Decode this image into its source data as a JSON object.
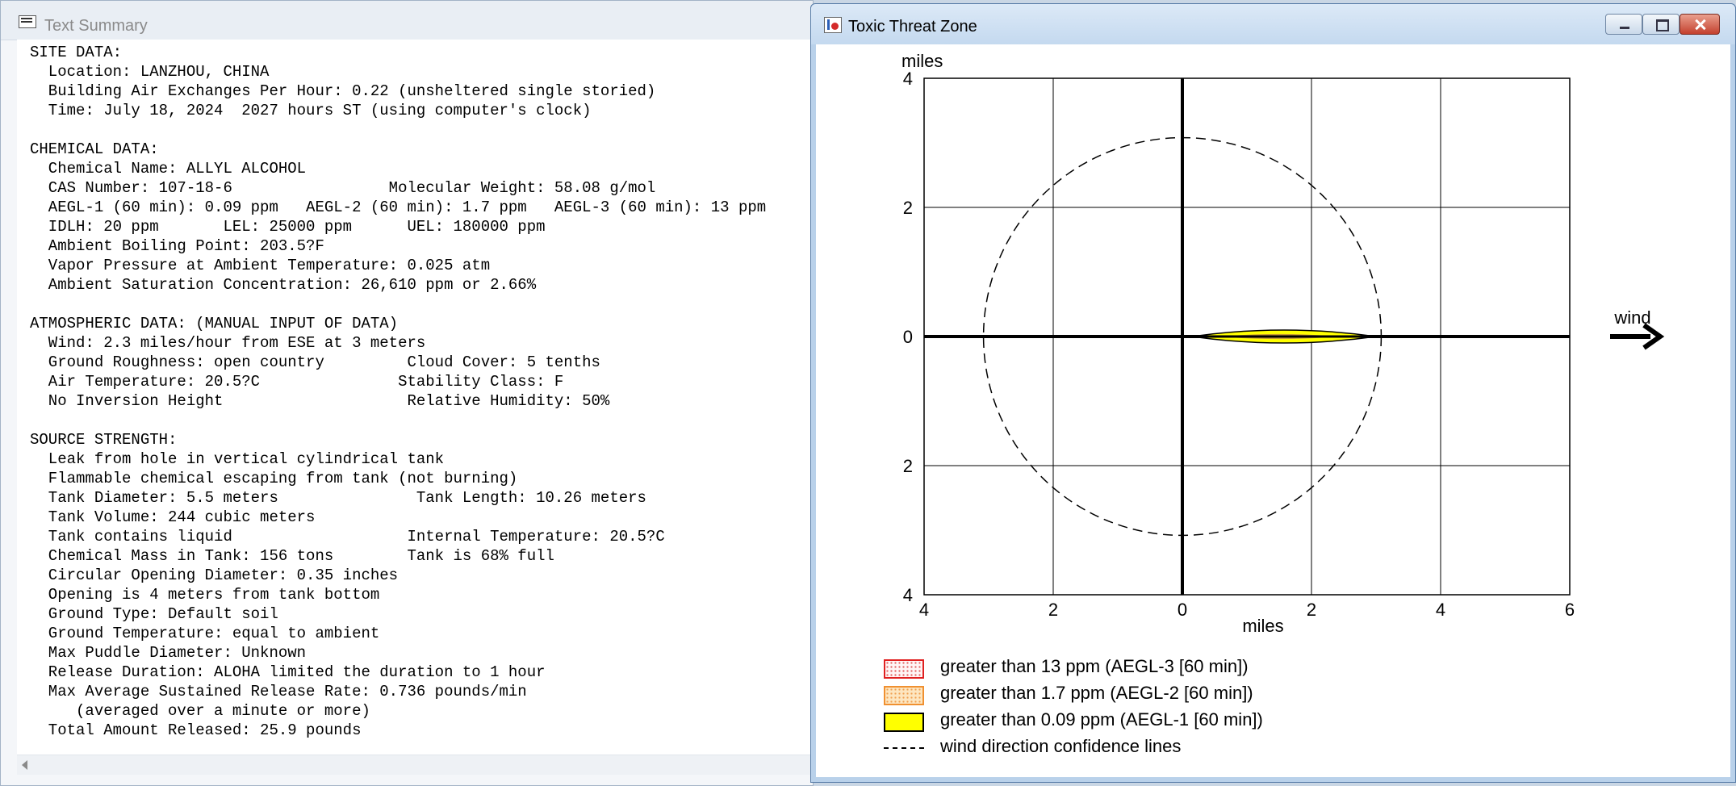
{
  "summary_window": {
    "title": "Text Summary",
    "lines": [
      "SITE DATA:",
      "  Location: LANZHOU, CHINA",
      "  Building Air Exchanges Per Hour: 0.22 (unsheltered single storied)",
      "  Time: July 18, 2024  2027 hours ST (using computer's clock)",
      "",
      "CHEMICAL DATA:",
      "  Chemical Name: ALLYL ALCOHOL",
      "  CAS Number: 107-18-6                 Molecular Weight: 58.08 g/mol",
      "  AEGL-1 (60 min): 0.09 ppm   AEGL-2 (60 min): 1.7 ppm   AEGL-3 (60 min): 13 ppm",
      "  IDLH: 20 ppm       LEL: 25000 ppm      UEL: 180000 ppm",
      "  Ambient Boiling Point: 203.5?F",
      "  Vapor Pressure at Ambient Temperature: 0.025 atm",
      "  Ambient Saturation Concentration: 26,610 ppm or 2.66%",
      "",
      "ATMOSPHERIC DATA: (MANUAL INPUT OF DATA)",
      "  Wind: 2.3 miles/hour from ESE at 3 meters",
      "  Ground Roughness: open country         Cloud Cover: 5 tenths",
      "  Air Temperature: 20.5?C               Stability Class: F",
      "  No Inversion Height                    Relative Humidity: 50%",
      "",
      "SOURCE STRENGTH:",
      "  Leak from hole in vertical cylindrical tank",
      "  Flammable chemical escaping from tank (not burning)",
      "  Tank Diameter: 5.5 meters               Tank Length: 10.26 meters",
      "  Tank Volume: 244 cubic meters",
      "  Tank contains liquid                   Internal Temperature: 20.5?C",
      "  Chemical Mass in Tank: 156 tons        Tank is 68% full",
      "  Circular Opening Diameter: 0.35 inches",
      "  Opening is 4 meters from tank bottom",
      "  Ground Type: Default soil",
      "  Ground Temperature: equal to ambient",
      "  Max Puddle Diameter: Unknown",
      "  Release Duration: ALOHA limited the duration to 1 hour",
      "  Max Average Sustained Release Rate: 0.736 pounds/min",
      "     (averaged over a minute or more)",
      "  Total Amount Released: 25.9 pounds"
    ]
  },
  "threat_window": {
    "title": "Toxic Threat Zone",
    "wind_label": "wind",
    "legend": [
      {
        "key": "aegl3",
        "label": "greater than 13 ppm (AEGL-3 [60 min])",
        "color": "#e02020"
      },
      {
        "key": "aegl2",
        "label": "greater than 1.7 ppm (AEGL-2 [60 min])",
        "color": "#f09030"
      },
      {
        "key": "aegl1",
        "label": "greater than 0.09 ppm (AEGL-1 [60 min])",
        "color": "#ffff00"
      },
      {
        "key": "confidence",
        "label": "wind direction confidence lines",
        "color": "#000000"
      }
    ]
  },
  "chart_data": {
    "type": "scatter",
    "xlabel": "miles",
    "ylabel": "miles",
    "xlim": [
      -4,
      6
    ],
    "ylim": [
      -4,
      4
    ],
    "x_ticks": [
      -4,
      -2,
      0,
      2,
      4,
      6
    ],
    "x_tick_labels": [
      "4",
      "2",
      "0",
      "2",
      "4",
      "6"
    ],
    "y_ticks": [
      4,
      2,
      0,
      -2,
      -4
    ],
    "y_tick_labels": [
      "4",
      "2",
      "0",
      "2",
      "4"
    ],
    "grid": true,
    "confidence_circle": {
      "center": [
        0,
        0
      ],
      "radius": 3.08
    },
    "aegl1_zone": {
      "x_start": 0.15,
      "x_end": 3.0,
      "max_half_width": 0.1
    },
    "aegl2_zone": {
      "x_start": 0.7,
      "x_end": 2.3,
      "max_half_width": 0.03
    }
  }
}
